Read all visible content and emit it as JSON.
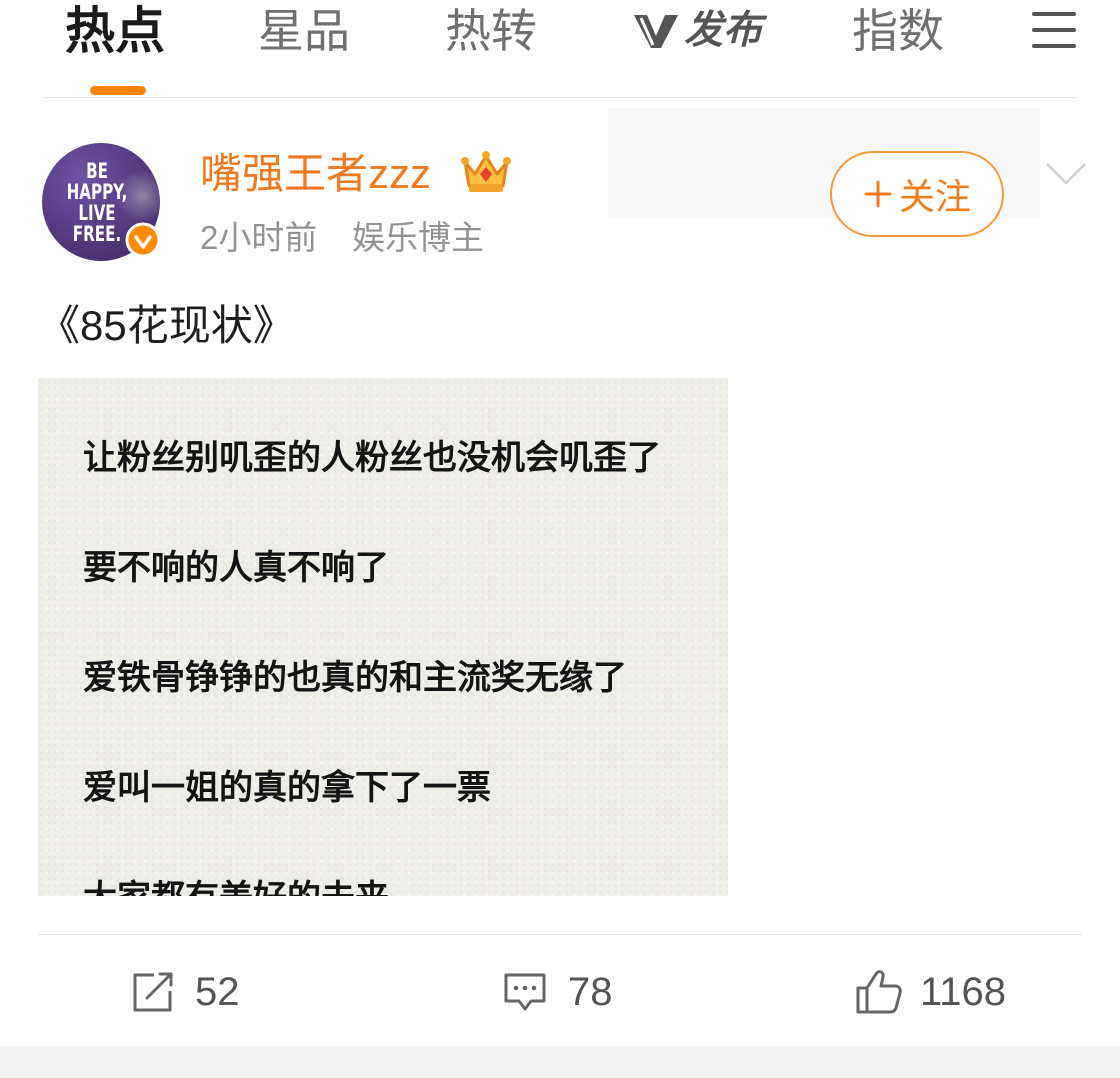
{
  "nav": {
    "tabs": [
      {
        "label": "热点",
        "active": true
      },
      {
        "label": "星品",
        "active": false
      },
      {
        "label": "热转",
        "active": false
      },
      {
        "label": "发布",
        "active": false,
        "icon": "v-logo-icon"
      },
      {
        "label": "指数",
        "active": false
      }
    ],
    "menu_icon": "hamburger-menu-icon"
  },
  "post": {
    "author": {
      "name": "嘴强王者zzz",
      "avatar_text": [
        "BE",
        "HAPPY,",
        "LIVE",
        "FREE."
      ],
      "vip_icon": "crown-icon",
      "verified_icon": "verified-badge-icon"
    },
    "time": "2小时前",
    "source": "娱乐博主",
    "follow": {
      "icon": "plus-icon",
      "label": "关注"
    },
    "more_icon": "chevron-down-icon",
    "text": "《85花现状》",
    "image_lines": [
      "让粉丝别叽歪的人粉丝也没机会叽歪了",
      "要不响的人真不响了",
      "爱铁骨铮铮的也真的和主流奖无缘了",
      "爱叫一姐的真的拿下了一票",
      "大家都有美好的未来"
    ]
  },
  "actions": [
    {
      "icon": "repost-icon",
      "count": "52"
    },
    {
      "icon": "comment-icon",
      "count": "78"
    },
    {
      "icon": "like-icon",
      "count": "1168"
    }
  ],
  "colors": {
    "accent": "#ff8200",
    "username": "#f0781e",
    "text_primary": "#1a1a1a",
    "text_secondary": "#939393",
    "icon_gray": "#666666",
    "image_bg": "#eeede8",
    "avatar_bg": "#56397f"
  }
}
